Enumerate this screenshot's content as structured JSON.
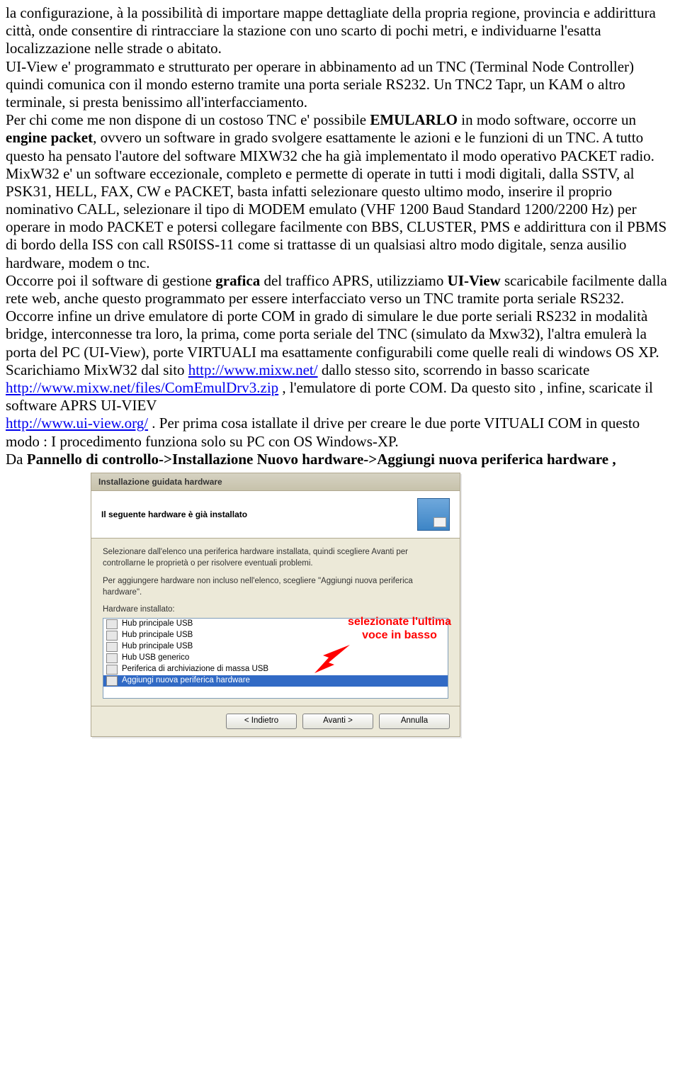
{
  "doc": {
    "p1_a": "la configurazione, à la possibilità di importare  mappe dettagliate della propria regione, provincia e addirittura città, onde consentire di rintracciare la stazione con uno scarto di pochi metri, e individuarne l'esatta localizzazione  nelle strade o abitato.",
    "p1_b": "UI-View e' programmato e strutturato per operare in abbinamento ad un TNC (Terminal Node Controller) quindi comunica con il mondo esterno tramite una  porta seriale RS232. Un TNC2 Tapr, un KAM  o altro terminale, si presta benissimo all'interfacciamento.",
    "p2_a": "Per chi come me non dispone di un costoso TNC e' possibile ",
    "p2_emularlo": "EMULARLO",
    "p2_b": " in modo software, occorre un ",
    "p2_engine": "engine  packet",
    "p2_c": ", ovvero un software in grado svolgere esattamente le azioni e le funzioni di un TNC. A tutto questo ha pensato l'autore del software MIXW32 che ha già implementato il modo operativo PACKET radio.",
    "p3": "MixW32 e' un software eccezionale, completo e permette di operate in tutti i modi digitali, dalla SSTV, al PSK31, HELL, FAX, CW  e PACKET, basta infatti selezionare questo ultimo modo, inserire il proprio nominativo CALL, selezionare il tipo di MODEM emulato (VHF 1200 Baud Standard 1200/2200 Hz) per operare in modo PACKET e potersi collegare facilmente con BBS, CLUSTER, PMS e addirittura con il PBMS di bordo della ISS con call RS0ISS-11 come si trattasse di un qualsiasi altro modo digitale, senza ausilio hardware,  modem o tnc.",
    "p4_a": "Occorre poi il software di gestione ",
    "p4_grafica": "grafica",
    "p4_b": " del traffico APRS, utilizziamo ",
    "p4_uiview": "UI-View",
    "p4_c": " scaricabile facilmente dalla rete web, anche  questo programmato per essere interfacciato verso un TNC tramite porta seriale RS232.",
    "p5": "Occorre infine un drive emulatore di porte COM in grado di simulare le due porte seriali RS232  in modalità bridge, interconnesse tra loro,  la prima, come porta seriale del TNC (simulato da  Mxw32), l'altra emulerà la porta del PC  (UI-View), porte VIRTUALI ma esattamente configurabili come quelle reali di windows OS XP.",
    "p6_a": "Scarichiamo MixW32 dal sito ",
    "p6_b": "   dallo stesso sito, scorrendo in basso scaricate  ",
    "p6_c": " ,   l'emulatore di porte COM.  Da questo sito , infine, scaricate il software APRS UI-VIEV ",
    "p6_d": " .  Per prima cosa istallate il drive per creare le due porte VITUALI  COM in questo modo :  I procedimento funziona solo su PC con OS Windows-XP.",
    "p7_a": "Da ",
    "p7_bold": "Pannello di controllo->Installazione Nuovo hardware->Aggiungi nuova periferica hardware ,"
  },
  "links": {
    "mixw_home": "http://www.mixw.net/",
    "mixw_driver": "http://www.mixw.net/files/ComEmulDrv3.zip",
    "uiview": "http://www.ui-view.org/"
  },
  "wizard": {
    "title": "Installazione guidata hardware",
    "header": "Il seguente hardware è già installato",
    "desc1": "Selezionare dall'elenco una periferica hardware installata, quindi scegliere Avanti per controllarne le proprietà o per risolvere eventuali problemi.",
    "desc2": "Per aggiungere hardware non incluso nell'elenco, scegliere \"Aggiungi nuova periferica hardware\".",
    "list_label": "Hardware installato:",
    "items": [
      "Hub principale USB",
      "Hub principale USB",
      "Hub principale USB",
      "Hub USB generico",
      "Periferica di archiviazione di massa USB",
      "Aggiungi nuova periferica hardware"
    ],
    "selected_index": 5,
    "buttons": {
      "back": "< Indietro",
      "next": "Avanti >",
      "cancel": "Annulla"
    },
    "callout_l1": "selezionate  l'ultima",
    "callout_l2": "voce in basso"
  }
}
